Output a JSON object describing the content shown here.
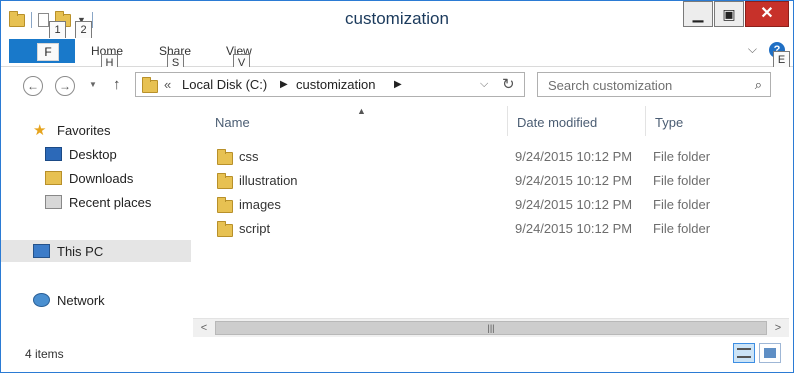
{
  "window": {
    "title": "customization"
  },
  "qat": {
    "keytips": [
      "1",
      "2"
    ]
  },
  "ribbon": {
    "file_keytip": "F",
    "tabs": [
      {
        "label": "Home",
        "keytip": "H"
      },
      {
        "label": "Share",
        "keytip": "S"
      },
      {
        "label": "View",
        "keytip": "V"
      }
    ],
    "help_keytip": "E",
    "help_icon": "?"
  },
  "address": {
    "overflow": "«",
    "crumbs": [
      "Local Disk (C:)",
      "customization"
    ]
  },
  "search": {
    "placeholder": "Search customization"
  },
  "nav_pane": {
    "favorites": "Favorites",
    "favorite_items": [
      "Desktop",
      "Downloads",
      "Recent places"
    ],
    "this_pc": "This PC",
    "network": "Network"
  },
  "columns": {
    "name": "Name",
    "date": "Date modified",
    "type": "Type"
  },
  "files": [
    {
      "name": "css",
      "date": "9/24/2015 10:12 PM",
      "type": "File folder"
    },
    {
      "name": "illustration",
      "date": "9/24/2015 10:12 PM",
      "type": "File folder"
    },
    {
      "name": "images",
      "date": "9/24/2015 10:12 PM",
      "type": "File folder"
    },
    {
      "name": "script",
      "date": "9/24/2015 10:12 PM",
      "type": "File folder"
    }
  ],
  "status": {
    "item_count": "4 items"
  },
  "colors": {
    "accent": "#1979ca",
    "close": "#c7312a",
    "folder": "#e7c152"
  }
}
